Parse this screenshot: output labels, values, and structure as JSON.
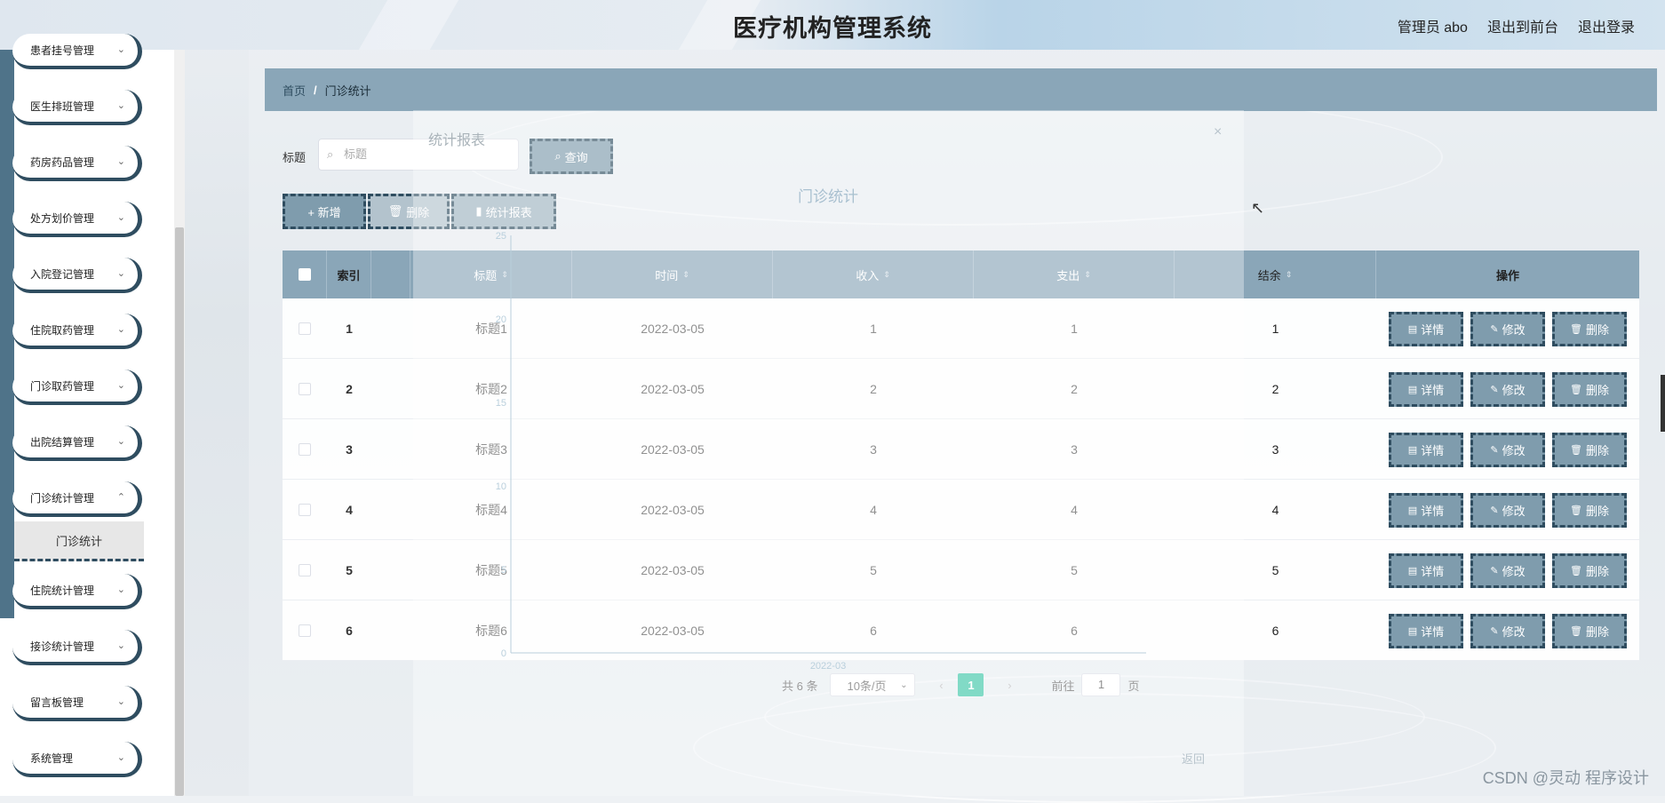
{
  "header": {
    "title": "医疗机构管理系统",
    "user_label": "管理员 abo",
    "front_link": "退出到前台",
    "logout_link": "退出登录"
  },
  "sidebar": {
    "items": [
      {
        "label": "患者挂号管理"
      },
      {
        "label": "医生排班管理"
      },
      {
        "label": "药房药品管理"
      },
      {
        "label": "处方划价管理"
      },
      {
        "label": "入院登记管理"
      },
      {
        "label": "住院取药管理"
      },
      {
        "label": "门诊取药管理"
      },
      {
        "label": "出院结算管理"
      },
      {
        "label": "门诊统计管理"
      },
      {
        "label": "住院统计管理"
      },
      {
        "label": "接诊统计管理"
      },
      {
        "label": "留言板管理"
      },
      {
        "label": "系统管理"
      }
    ],
    "active_sub": "门诊统计"
  },
  "breadcrumb": {
    "home": "首页",
    "sep": "/",
    "current": "门诊统计"
  },
  "search": {
    "label": "标题",
    "placeholder": "标题",
    "button": "查询"
  },
  "actions": {
    "add": "+ 新增",
    "delete": "删除",
    "stats": "统计报表"
  },
  "table": {
    "columns": {
      "index": "索引",
      "title": "标题",
      "time": "时间",
      "income": "收入",
      "expense": "支出",
      "balance": "结余",
      "ops": "操作"
    },
    "rows": [
      {
        "index": "1",
        "title": "标题1",
        "time": "2022-03-05",
        "income": "1",
        "expense": "1",
        "balance": "1"
      },
      {
        "index": "2",
        "title": "标题2",
        "time": "2022-03-05",
        "income": "2",
        "expense": "2",
        "balance": "2"
      },
      {
        "index": "3",
        "title": "标题3",
        "time": "2022-03-05",
        "income": "3",
        "expense": "3",
        "balance": "3"
      },
      {
        "index": "4",
        "title": "标题4",
        "time": "2022-03-05",
        "income": "4",
        "expense": "4",
        "balance": "4"
      },
      {
        "index": "5",
        "title": "标题5",
        "time": "2022-03-05",
        "income": "5",
        "expense": "5",
        "balance": "5"
      },
      {
        "index": "6",
        "title": "标题6",
        "time": "2022-03-05",
        "income": "6",
        "expense": "6",
        "balance": "6"
      }
    ],
    "row_buttons": {
      "detail": "详情",
      "edit": "修改",
      "delete": "删除"
    }
  },
  "pagination": {
    "total": "共 6 条",
    "page_size": "10条/页",
    "current": "1",
    "goto_label": "前往",
    "goto_value": "1",
    "page_suffix": "页"
  },
  "dialog": {
    "title": "统计报表",
    "close": "×",
    "chart_title": "门诊统计",
    "back": "返回",
    "y_ticks": [
      "25",
      "20",
      "15",
      "10",
      "5",
      "0"
    ],
    "x_label": "2022-03"
  },
  "watermark": "CSDN @灵动 程序设计",
  "colors": {
    "accent": "#8aa6b8",
    "dark": "#2f4d60",
    "pager_active": "#3ec6a8"
  }
}
